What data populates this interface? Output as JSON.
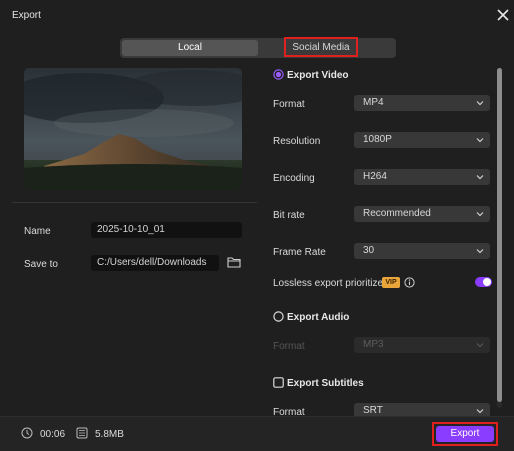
{
  "window": {
    "title": "Export"
  },
  "tabs": {
    "local": "Local",
    "social": "Social Media"
  },
  "left": {
    "name_label": "Name",
    "name_value": "2025-10-10_01",
    "saveto_label": "Save to",
    "saveto_value": "C:/Users/dell/Downloads"
  },
  "video": {
    "section": "Export Video",
    "format_label": "Format",
    "format_value": "MP4",
    "resolution_label": "Resolution",
    "resolution_value": "1080P",
    "encoding_label": "Encoding",
    "encoding_value": "H264",
    "bitrate_label": "Bit rate",
    "bitrate_value": "Recommended",
    "framerate_label": "Frame Rate",
    "framerate_value": "30",
    "lossless_label": "Lossless export prioritized",
    "vip_badge": "VIP"
  },
  "audio": {
    "section": "Export Audio",
    "format_label": "Format",
    "format_value": "MP3"
  },
  "subtitles": {
    "section": "Export Subtitles",
    "format_label": "Format",
    "format_value": "SRT"
  },
  "footer": {
    "duration": "00:06",
    "size": "5.8MB",
    "export_label": "Export"
  },
  "colors": {
    "accent": "#8a3cff",
    "highlight": "#e0201f"
  }
}
